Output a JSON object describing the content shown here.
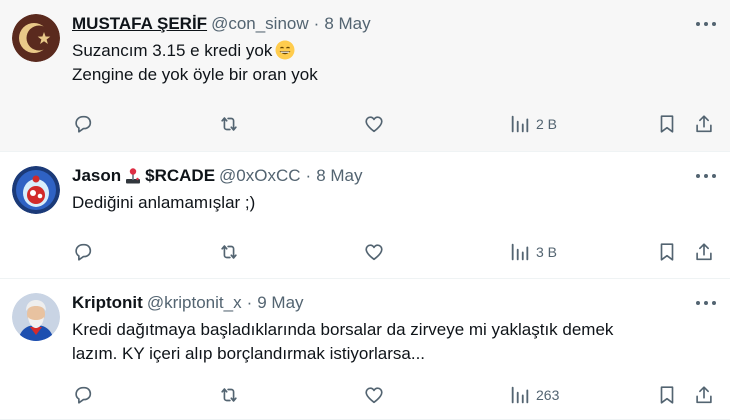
{
  "tweets": [
    {
      "author": "MUSTAFA ŞERİF",
      "handle": "@con_sinow",
      "separator": "·",
      "date": "8 May",
      "lines": [
        "Suzancım 3.15 e kredi yok",
        "Zengine de yok öyle bir oran yok"
      ],
      "views": "2 B"
    },
    {
      "author": "Jason",
      "author_suffix": "$RCADE",
      "handle": "@0xOxCC",
      "separator": "·",
      "date": "8 May",
      "lines": [
        "Dediğini anlamamışlar ;)"
      ],
      "views": "3 B"
    },
    {
      "author": "Kriptonit",
      "handle": "@kriptonit_x",
      "separator": "·",
      "date": "9 May",
      "lines": [
        "Kredi dağıtmaya başladıklarında borsalar da zirveye mi yaklaştık demek",
        "lazım. KY içeri alıp borçlandırmak istiyorlarsa..."
      ],
      "views": "263"
    }
  ],
  "colors": {
    "muted": "#536471",
    "text": "#0f1419",
    "highlight_bg": "#f7f7f7"
  }
}
